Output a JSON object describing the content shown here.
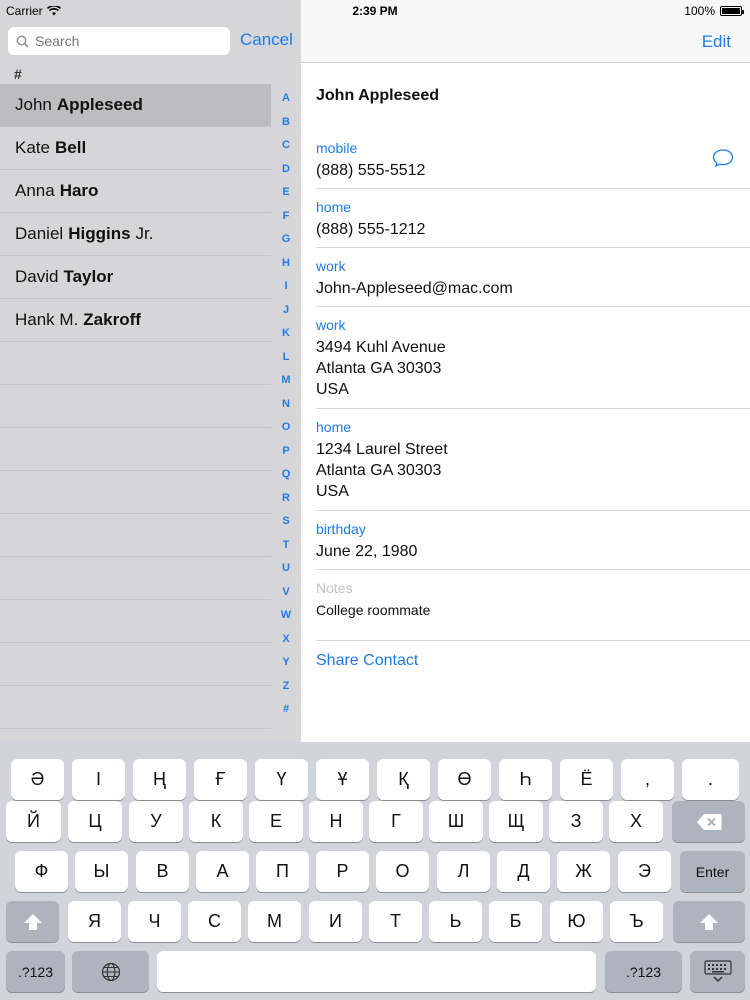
{
  "status": {
    "carrier": "Carrier",
    "time": "2:39 PM",
    "battery": "100%"
  },
  "search": {
    "placeholder": "Search",
    "cancel_label": "Cancel"
  },
  "list": {
    "section_header": "#",
    "contacts": [
      {
        "first": "John",
        "last": "Appleseed",
        "suffix": ""
      },
      {
        "first": "Kate",
        "last": "Bell",
        "suffix": ""
      },
      {
        "first": "Anna",
        "last": "Haro",
        "suffix": ""
      },
      {
        "first": "Daniel",
        "last": "Higgins",
        "suffix": "Jr."
      },
      {
        "first": "David",
        "last": "Taylor",
        "suffix": ""
      },
      {
        "first": "Hank M.",
        "last": "Zakroff",
        "suffix": ""
      }
    ],
    "index": [
      "A",
      "B",
      "C",
      "D",
      "E",
      "F",
      "G",
      "H",
      "I",
      "J",
      "K",
      "L",
      "M",
      "N",
      "O",
      "P",
      "Q",
      "R",
      "S",
      "T",
      "U",
      "V",
      "W",
      "X",
      "Y",
      "Z",
      "#"
    ]
  },
  "detail": {
    "edit_label": "Edit",
    "name": "John Appleseed",
    "mobile_label": "mobile",
    "mobile_value": "(888) 555-5512",
    "home_label": "home",
    "home_value": "(888) 555-1212",
    "email_label": "work",
    "email_value": "John-Appleseed@mac.com",
    "work_addr_label": "work",
    "work_addr_1": "3494 Kuhl Avenue",
    "work_addr_2": "Atlanta GA 30303",
    "work_addr_3": "USA",
    "home_addr_label": "home",
    "home_addr_1": "1234 Laurel Street",
    "home_addr_2": "Atlanta GA 30303",
    "home_addr_3": "USA",
    "birthday_label": "birthday",
    "birthday_value": "June 22, 1980",
    "notes_label": "Notes",
    "notes_value": "College roommate",
    "share_label": "Share Contact"
  },
  "keyboard": {
    "row1": [
      "Ә",
      "І",
      "Ң",
      "Ғ",
      "Ү",
      "Ұ",
      "Қ",
      "Ө",
      "Һ",
      "Ё",
      ",",
      "."
    ],
    "row2": [
      "Й",
      "Ц",
      "У",
      "К",
      "Е",
      "Н",
      "Г",
      "Ш",
      "Щ",
      "З",
      "Х"
    ],
    "row3": [
      "Ф",
      "Ы",
      "В",
      "А",
      "П",
      "Р",
      "О",
      "Л",
      "Д",
      "Ж",
      "Э"
    ],
    "row4": [
      "Я",
      "Ч",
      "С",
      "М",
      "И",
      "Т",
      "Ь",
      "Б",
      "Ю",
      "Ъ"
    ],
    "enter_label": "Enter",
    "numbers_label": ".?123"
  },
  "colors": {
    "accent": "#1f7ce8",
    "keyboard_bg": "#d1d5db",
    "list_bg": "#d6d6d8"
  }
}
